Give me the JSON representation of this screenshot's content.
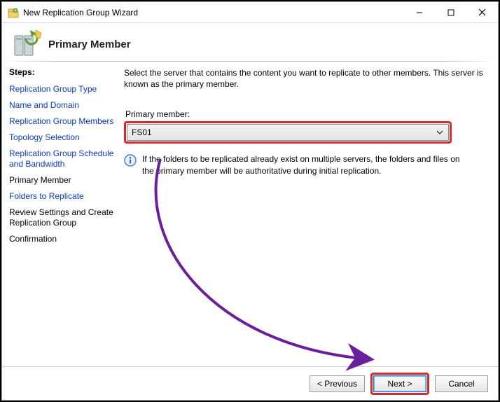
{
  "window": {
    "title": "New Replication Group Wizard"
  },
  "header": {
    "title": "Primary Member"
  },
  "sidebar": {
    "heading": "Steps:",
    "items": [
      {
        "label": "Replication Group Type",
        "style": "link"
      },
      {
        "label": "Name and Domain",
        "style": "link"
      },
      {
        "label": "Replication Group Members",
        "style": "link"
      },
      {
        "label": "Topology Selection",
        "style": "link"
      },
      {
        "label": "Replication Group Schedule and Bandwidth",
        "style": "link"
      },
      {
        "label": "Primary Member",
        "style": "plain"
      },
      {
        "label": "Folders to Replicate",
        "style": "link"
      },
      {
        "label": "Review Settings and Create Replication Group",
        "style": "plain"
      },
      {
        "label": "Confirmation",
        "style": "plain"
      }
    ]
  },
  "content": {
    "instruction": "Select the server that contains the content you want to replicate to other members. This server is known as the primary member.",
    "primary_member_label": "Primary member:",
    "primary_member_value": "FS01",
    "info_text": "If the folders to be replicated already exist on multiple servers, the folders and files on the primary member will be authoritative during initial replication."
  },
  "footer": {
    "previous": "< Previous",
    "next": "Next >",
    "cancel": "Cancel"
  },
  "colors": {
    "highlight": "#d42a2a",
    "link": "#0b3db7",
    "arrow": "#6b1f9c"
  }
}
